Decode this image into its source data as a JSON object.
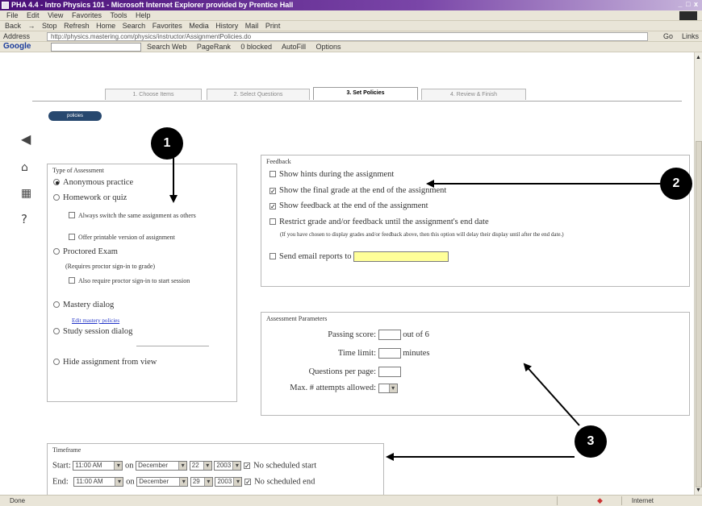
{
  "window": {
    "title": "PHA 4.4 - Intro Physics 101 - Microsoft Internet Explorer provided by Prentice Hall",
    "controls": "_ □ x"
  },
  "menubar": {
    "items": [
      "File",
      "Edit",
      "View",
      "Favorites",
      "Tools",
      "Help"
    ]
  },
  "toolbar": {
    "items": [
      "Back",
      "→",
      "Stop",
      "Refresh",
      "Home",
      "Search",
      "Favorites",
      "Media",
      "History",
      "Mail",
      "Print"
    ]
  },
  "addressbar": {
    "label": "Address",
    "url": "http://physics.mastering.com/physics/instructor/AssignmentPolicies.do",
    "go": "Go",
    "links": "Links"
  },
  "googlebar": {
    "logo": "Google",
    "items": [
      "Search Web",
      "PageRank",
      "0 blocked",
      "AutoFill",
      "Options"
    ]
  },
  "tabs": [
    "1. Choose Items",
    "2. Select Questions",
    "3. Set Policies",
    "4. Review & Finish"
  ],
  "pill_label": "policies",
  "sidebar_icons": [
    "back-arrow-icon",
    "home-icon",
    "grid-icon",
    "help-icon"
  ],
  "type_panel": {
    "header": "Type of Assessment",
    "options": [
      "Anonymous practice",
      "Homework or quiz",
      "Always switch the same assignment as others",
      "Offer printable version of assignment",
      "Proctored Exam",
      "(Requires proctor sign-in to grade)",
      "Also require proctor sign-in to start session",
      "Mastery dialog",
      "Edit mastery policies",
      "Study session dialog",
      "Hide assignment from view"
    ]
  },
  "feedback_panel": {
    "header": "Feedback",
    "items": [
      "Show hints during the assignment",
      "Show the final grade at the end of the assignment",
      "Show feedback at the end of the assignment",
      "Restrict grade and/or feedback until the assignment's end date",
      "(If you have chosen to display grades and/or feedback above, then this option will delay their display until after the end date.)",
      "Send email reports to"
    ],
    "checked": [
      false,
      true,
      true,
      false,
      false
    ]
  },
  "params_panel": {
    "header": "Assessment Parameters",
    "passing_label": "Passing score:",
    "passing_suffix": "out of 6",
    "time_label": "Time limit:",
    "time_suffix": "minutes",
    "qpp_label": "Questions per page:",
    "attempts_label": "Max. # attempts allowed:"
  },
  "timeline_panel": {
    "header": "Timeframe",
    "start_label": "Start:",
    "end_label": "End:",
    "time": "11:00 AM",
    "on": "on",
    "month": "December",
    "start_day": "22",
    "end_day": "29",
    "year": "2003",
    "no_start": "No scheduled start",
    "no_end": "No scheduled end"
  },
  "callouts": [
    "1",
    "2",
    "3"
  ],
  "statusbar": {
    "status": "Done",
    "zone": "Internet"
  }
}
